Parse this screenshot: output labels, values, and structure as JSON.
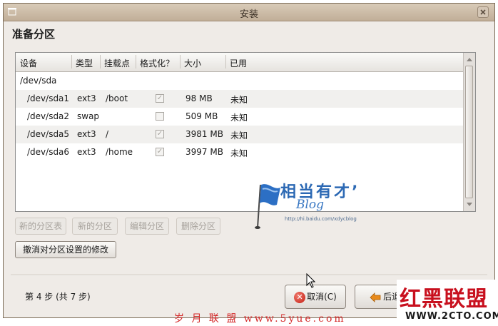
{
  "window": {
    "title": "安装"
  },
  "page": {
    "title": "准备分区"
  },
  "table": {
    "columns": [
      "设备",
      "类型",
      "挂载点",
      "格式化？",
      "大小",
      "已用"
    ],
    "parent_device": "/dev/sda",
    "rows": [
      {
        "device": "/dev/sda1",
        "type": "ext3",
        "mount": "/boot",
        "format": true,
        "size": "98 MB",
        "used": "未知"
      },
      {
        "device": "/dev/sda2",
        "type": "swap",
        "mount": "",
        "format": false,
        "size": "509 MB",
        "used": "未知"
      },
      {
        "device": "/dev/sda5",
        "type": "ext3",
        "mount": "/",
        "format": true,
        "size": "3981 MB",
        "used": "未知"
      },
      {
        "device": "/dev/sda6",
        "type": "ext3",
        "mount": "/home",
        "format": true,
        "size": "3997 MB",
        "used": "未知"
      }
    ]
  },
  "actions": {
    "new_table": "新的分区表",
    "new_partition": "新的分区",
    "edit_partition": "编辑分区",
    "delete_partition": "删除分区",
    "undo": "撤消对分区设置的修改"
  },
  "footer": {
    "step": "第 4 步 (共 7 步)",
    "cancel": "取消(C)",
    "back": "后退("
  },
  "watermarks": {
    "blog_title": "相当有才’",
    "blog_word": "Blog",
    "blog_url": "http://hi.baidu.com/xdycblog",
    "bottom_text": "岁 月 联 盟   www.5yue.com",
    "logo_main": "红黑联盟",
    "logo_url": "WWW.2CTO.COM"
  },
  "colors": {
    "titlebar": "#c9b8a3",
    "window_bg": "#efebe7",
    "row_alt": "#f1f0ee",
    "cancel_red": "#c41d12",
    "back_orange": "#e88a1a",
    "watermark_blue": "#2c69b4",
    "logo_red": "#c8101e"
  },
  "icons": {
    "cancel": "cancel-icon",
    "back": "back-arrow-icon",
    "cursor": "mouse-cursor-icon",
    "flag": "flag-icon"
  }
}
